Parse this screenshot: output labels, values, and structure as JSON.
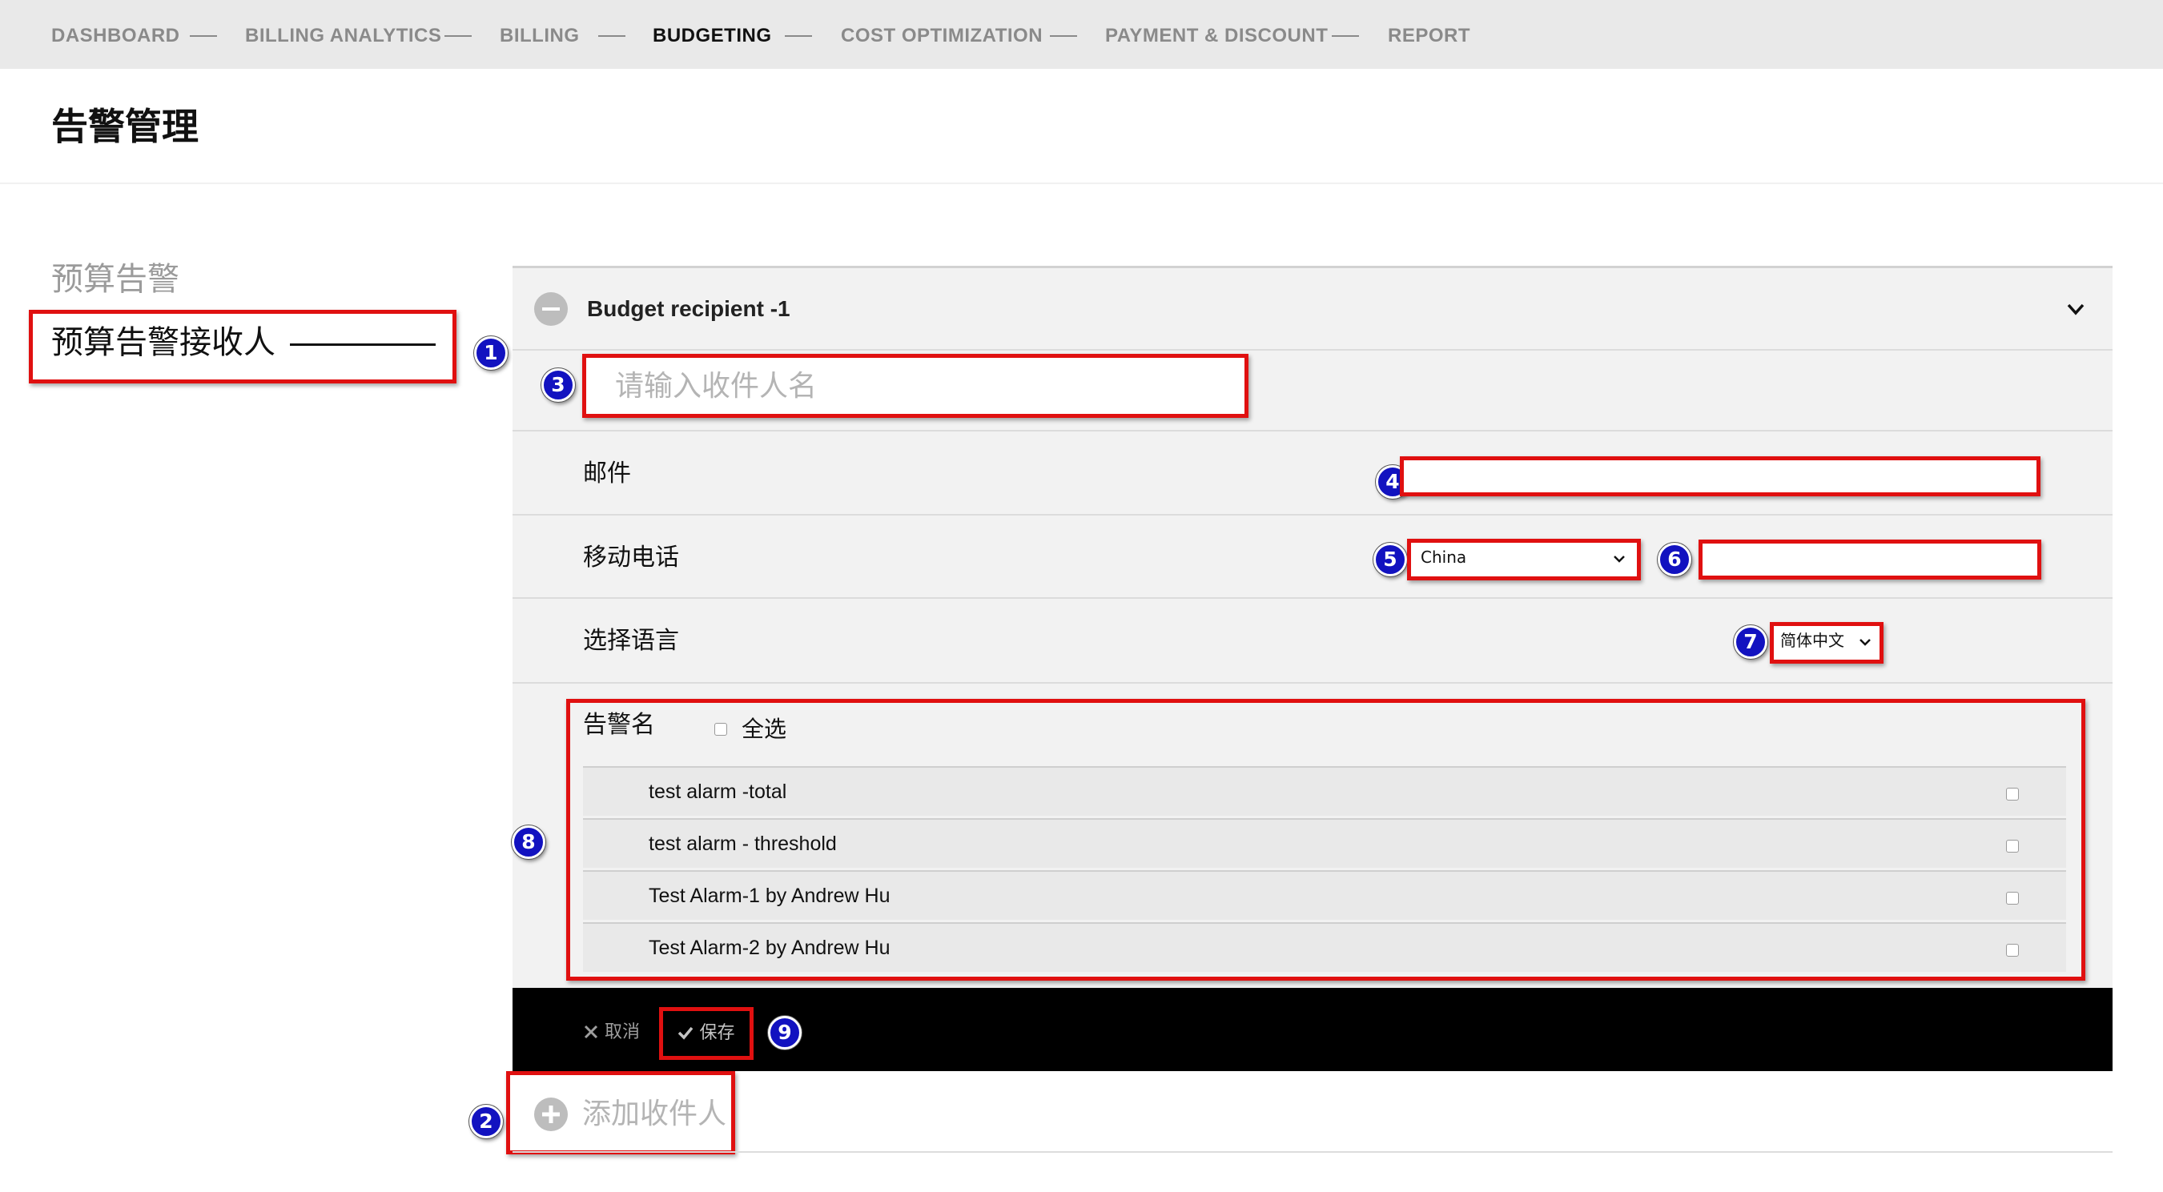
{
  "nav": {
    "items": [
      "DASHBOARD",
      "BILLING ANALYTICS",
      "BILLING",
      "BUDGETING",
      "COST OPTIMIZATION",
      "PAYMENT & DISCOUNT",
      "REPORT"
    ],
    "active": "BUDGETING"
  },
  "page_title": "告警管理",
  "sidebar": {
    "items": [
      "预算告警",
      "预算告警接收人"
    ],
    "selected": "预算告警接收人"
  },
  "recipient": {
    "title": "Budget recipient -1",
    "name_placeholder": "请输入收件人名",
    "email_label": "邮件",
    "email_value": "",
    "mobile_label": "移动电话",
    "country_value": "China",
    "phone_value": "",
    "language_label": "选择语言",
    "language_value": "简体中文",
    "alarm_header": "告警名",
    "select_all_label": "全选",
    "alarms": [
      "test alarm -total",
      "test alarm - threshold",
      "Test Alarm-1 by Andrew Hu",
      "Test Alarm-2 by Andrew Hu"
    ]
  },
  "footer": {
    "cancel_label": "取消",
    "save_label": "保存"
  },
  "add_recipient_label": "添加收件人",
  "annotations": [
    "1",
    "2",
    "3",
    "4",
    "5",
    "6",
    "7",
    "8",
    "9"
  ],
  "colors": {
    "annotation_box": "#e01010",
    "badge": "#1212c0",
    "footer_bar": "#000000",
    "panel_bg": "#f2f2f2",
    "nav_bg": "#e9e9e9"
  }
}
